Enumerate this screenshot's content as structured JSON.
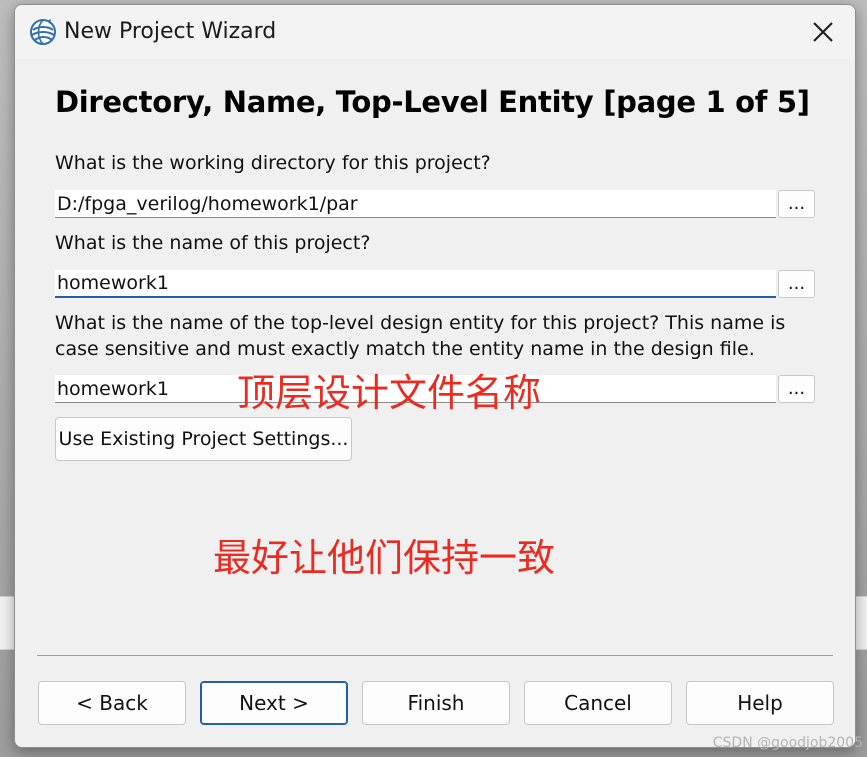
{
  "window": {
    "title": "New Project Wizard",
    "icon": "quartus-globe-icon",
    "close_icon": "close-icon"
  },
  "page": {
    "heading": "Directory, Name, Top-Level Entity [page 1 of 5]"
  },
  "fields": {
    "directory": {
      "label": "What is the working directory for this project?",
      "value": "D:/fpga_verilog/homework1/par",
      "browse_label": "..."
    },
    "project_name": {
      "label": "What is the name of this project?",
      "value": "homework1",
      "browse_label": "..."
    },
    "top_level_entity": {
      "label_line1": "What is the name of the top-level design entity for this project? This name is",
      "label_line2": "case sensitive and must exactly match the entity name in the design file.",
      "value": "homework1",
      "browse_label": "..."
    }
  },
  "use_existing_label": "Use Existing Project Settings...",
  "annotations": {
    "top_level_note": "顶层设计文件名称",
    "consistency_note": "最好让他们保持一致",
    "color": "#ea2b21"
  },
  "footer": {
    "back_label": "< Back",
    "next_label": "Next >",
    "finish_label": "Finish",
    "cancel_label": "Cancel",
    "help_label": "Help"
  },
  "watermark": "CSDN @goodjob2005",
  "colors": {
    "dialog_bg": "#f0f0f0",
    "focus_accent": "#1f5fa8"
  }
}
